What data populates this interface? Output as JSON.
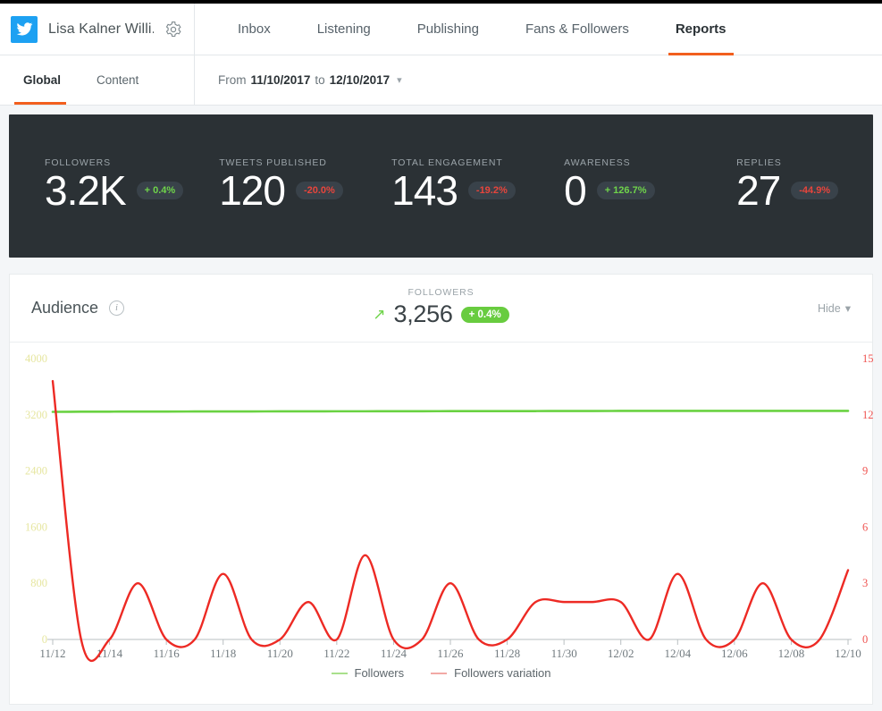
{
  "header": {
    "account_name": "Lisa Kalner Willi...",
    "logo_icon": "twitter-bird-icon",
    "settings_icon": "gear-icon",
    "tabs": [
      {
        "label": "Inbox",
        "active": false
      },
      {
        "label": "Listening",
        "active": false
      },
      {
        "label": "Publishing",
        "active": false
      },
      {
        "label": "Fans & Followers",
        "active": false
      },
      {
        "label": "Reports",
        "active": true
      }
    ]
  },
  "subnav": {
    "tabs": [
      {
        "label": "Global",
        "active": true
      },
      {
        "label": "Content",
        "active": false
      }
    ],
    "date_prefix": "From",
    "date_from": "11/10/2017",
    "date_mid": "to",
    "date_to": "12/10/2017",
    "caret_icon": "chevron-down-icon"
  },
  "kpis": [
    {
      "label": "FOLLOWERS",
      "value": "3.2K",
      "delta": "+ 0.4%",
      "direction": "up"
    },
    {
      "label": "TWEETS PUBLISHED",
      "value": "120",
      "delta": "-20.0%",
      "direction": "down"
    },
    {
      "label": "TOTAL ENGAGEMENT",
      "value": "143",
      "delta": "-19.2%",
      "direction": "down"
    },
    {
      "label": "AWARENESS",
      "value": "0",
      "delta": "+ 126.7%",
      "direction": "up"
    },
    {
      "label": "REPLIES",
      "value": "27",
      "delta": "-44.9%",
      "direction": "down"
    }
  ],
  "audience": {
    "title": "Audience",
    "info_icon": "info-icon",
    "metric_label": "FOLLOWERS",
    "metric_arrow_icon": "arrow-up-right-icon",
    "metric_value": "3,256",
    "metric_badge": "+ 0.4%",
    "hide_label": "Hide",
    "hide_caret_icon": "chevron-down-icon"
  },
  "colors": {
    "accent_orange": "#f25f1e",
    "twitter_blue": "#1da1f2",
    "panel_dark": "#2b3135",
    "green": "#68cc3f",
    "green_line": "#6ad242",
    "red_line": "#ed2a24",
    "left_axis_text": "#e6e6a0",
    "right_axis_text": "#ef5350",
    "badge_green": "#68cc3f",
    "up_text": "#6fd44a",
    "down_text": "#e8453c"
  },
  "chart_data": {
    "type": "line",
    "title": "Audience",
    "xlabel": "",
    "ylabel": "",
    "grid": false,
    "legend_position": "bottom",
    "x": [
      "11/12",
      "11/13",
      "11/14",
      "11/15",
      "11/16",
      "11/17",
      "11/18",
      "11/19",
      "11/20",
      "11/21",
      "11/22",
      "11/23",
      "11/24",
      "11/25",
      "11/26",
      "11/27",
      "11/28",
      "11/29",
      "11/30",
      "12/01",
      "12/02",
      "12/03",
      "12/04",
      "12/05",
      "12/06",
      "12/07",
      "12/08",
      "12/09",
      "12/10"
    ],
    "xtick_labels": [
      "11/12",
      "11/14",
      "11/16",
      "11/18",
      "11/20",
      "11/22",
      "11/24",
      "11/26",
      "11/28",
      "11/30",
      "12/02",
      "12/04",
      "12/06",
      "12/08",
      "12/10"
    ],
    "left_axis": {
      "ticks": [
        0,
        800,
        1600,
        2400,
        3200,
        4000
      ],
      "ylim": [
        0,
        4000
      ],
      "tick_labels": [
        "0",
        "800",
        "1600",
        "2400",
        "3200",
        "4000"
      ]
    },
    "right_axis": {
      "ticks": [
        0,
        3,
        6,
        9,
        12,
        15
      ],
      "ylim": [
        0,
        15
      ],
      "tick_labels": [
        "0",
        "3",
        "6",
        "9",
        "12",
        "15"
      ]
    },
    "series": [
      {
        "name": "Followers",
        "axis": "left",
        "color": "#6ad242",
        "values": [
          3242,
          3244,
          3245,
          3246,
          3246,
          3247,
          3248,
          3248,
          3249,
          3249,
          3250,
          3250,
          3251,
          3251,
          3252,
          3252,
          3253,
          3253,
          3254,
          3254,
          3255,
          3255,
          3255,
          3256,
          3256,
          3256,
          3256,
          3256,
          3256
        ]
      },
      {
        "name": "Followers variation",
        "axis": "right",
        "color": "#ed2a24",
        "values": [
          13.8,
          0,
          0,
          3,
          0,
          0,
          3.5,
          0,
          0,
          2,
          0,
          4.5,
          0,
          0,
          3,
          0,
          0,
          2,
          2,
          2,
          2,
          0,
          3.5,
          0,
          0,
          3,
          0,
          0,
          3.7
        ]
      }
    ],
    "legend": [
      {
        "label": "Followers",
        "color": "#a9e08c"
      },
      {
        "label": "Followers variation",
        "color": "#f2a9a5"
      }
    ]
  }
}
